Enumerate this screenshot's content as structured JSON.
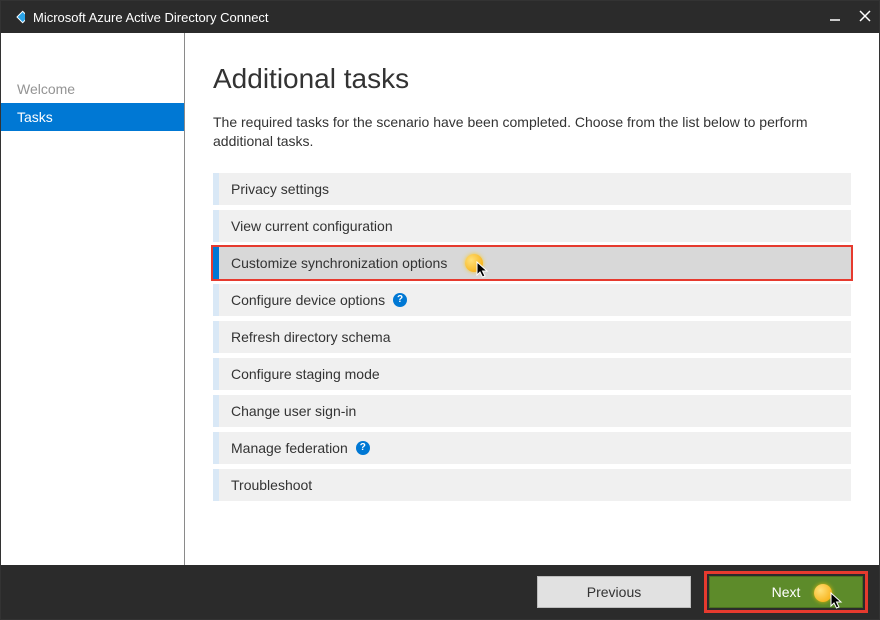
{
  "window": {
    "title": "Microsoft Azure Active Directory Connect"
  },
  "sidebar": {
    "items": [
      {
        "label": "Welcome",
        "active": false
      },
      {
        "label": "Tasks",
        "active": true
      }
    ]
  },
  "page": {
    "title": "Additional tasks",
    "description": "The required tasks for the scenario have been completed. Choose from the list below to perform additional tasks."
  },
  "tasks": [
    {
      "label": "Privacy settings",
      "info": false,
      "selected": false
    },
    {
      "label": "View current configuration",
      "info": false,
      "selected": false
    },
    {
      "label": "Customize synchronization options",
      "info": false,
      "selected": true
    },
    {
      "label": "Configure device options",
      "info": true,
      "selected": false
    },
    {
      "label": "Refresh directory schema",
      "info": false,
      "selected": false
    },
    {
      "label": "Configure staging mode",
      "info": false,
      "selected": false
    },
    {
      "label": "Change user sign-in",
      "info": false,
      "selected": false
    },
    {
      "label": "Manage federation",
      "info": true,
      "selected": false
    },
    {
      "label": "Troubleshoot",
      "info": false,
      "selected": false
    }
  ],
  "footer": {
    "previous": "Previous",
    "next": "Next"
  },
  "colors": {
    "accent": "#0078d4",
    "highlight_outline": "#e63a2e",
    "next_button": "#5d8b2a"
  }
}
